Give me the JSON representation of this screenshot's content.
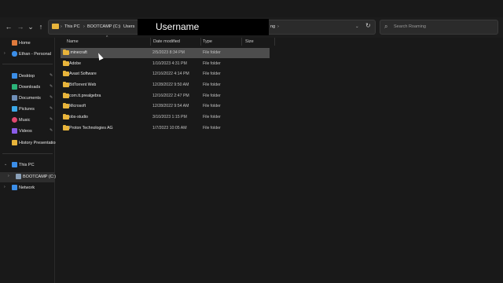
{
  "address": {
    "crumbs": [
      "This PC",
      "BOOTCAMP (C:)",
      "Users"
    ],
    "redacted_label": "Username",
    "tail_crumb": "ng"
  },
  "search": {
    "placeholder": "Search Roaming"
  },
  "nav": {
    "back": "←",
    "forward": "→",
    "recent": "⌄",
    "up": "↑",
    "refresh": "↻",
    "expand": "⌄"
  },
  "sidebar": {
    "quick": [
      {
        "label": "Home",
        "icon": "home-icon",
        "color": "#e07a3c"
      },
      {
        "label": "Ethan - Personal",
        "icon": "cloud-icon",
        "color": "#3b8ee8"
      }
    ],
    "pinned": [
      {
        "label": "Desktop",
        "icon": "desktop-icon",
        "color": "#3b8ee8"
      },
      {
        "label": "Downloads",
        "icon": "download-icon",
        "color": "#2bb57a"
      },
      {
        "label": "Documents",
        "icon": "document-icon",
        "color": "#6f8fb8"
      },
      {
        "label": "Pictures",
        "icon": "pictures-icon",
        "color": "#3ba8e8"
      },
      {
        "label": "Music",
        "icon": "music-icon",
        "color": "#e0476f"
      },
      {
        "label": "Videos",
        "icon": "video-icon",
        "color": "#8a5ce8"
      },
      {
        "label": "History Presentation",
        "icon": "folder-icon",
        "color": "#e8b43b"
      }
    ],
    "tree": [
      {
        "label": "This PC",
        "icon": "computer-icon",
        "color": "#3b8ee8"
      },
      {
        "label": "BOOTCAMP (C:)",
        "icon": "drive-icon",
        "color": "#8aa0b8"
      },
      {
        "label": "Network",
        "icon": "network-icon",
        "color": "#3b8ee8"
      }
    ]
  },
  "columns": {
    "name": "Name",
    "date": "Date modified",
    "type": "Type",
    "size": "Size"
  },
  "files": [
    {
      "name": ".minecraft",
      "date": "2/5/2023 8:34 PM",
      "type": "File folder"
    },
    {
      "name": "Adobe",
      "date": "1/10/2023 4:31 PM",
      "type": "File folder"
    },
    {
      "name": "Avast Software",
      "date": "12/16/2022 4:14 PM",
      "type": "File folder"
    },
    {
      "name": "BitTorrent Web",
      "date": "12/28/2022 9:50 AM",
      "type": "File folder"
    },
    {
      "name": "com.tt.prealgebra",
      "date": "12/16/2022 2:47 PM",
      "type": "File folder"
    },
    {
      "name": "Microsoft",
      "date": "12/28/2022 9:54 AM",
      "type": "File folder"
    },
    {
      "name": "obs-studio",
      "date": "3/10/2023 1:15 PM",
      "type": "File folder"
    },
    {
      "name": "Proton Technologies AG",
      "date": "1/7/2023 10:05 AM",
      "type": "File folder"
    }
  ]
}
